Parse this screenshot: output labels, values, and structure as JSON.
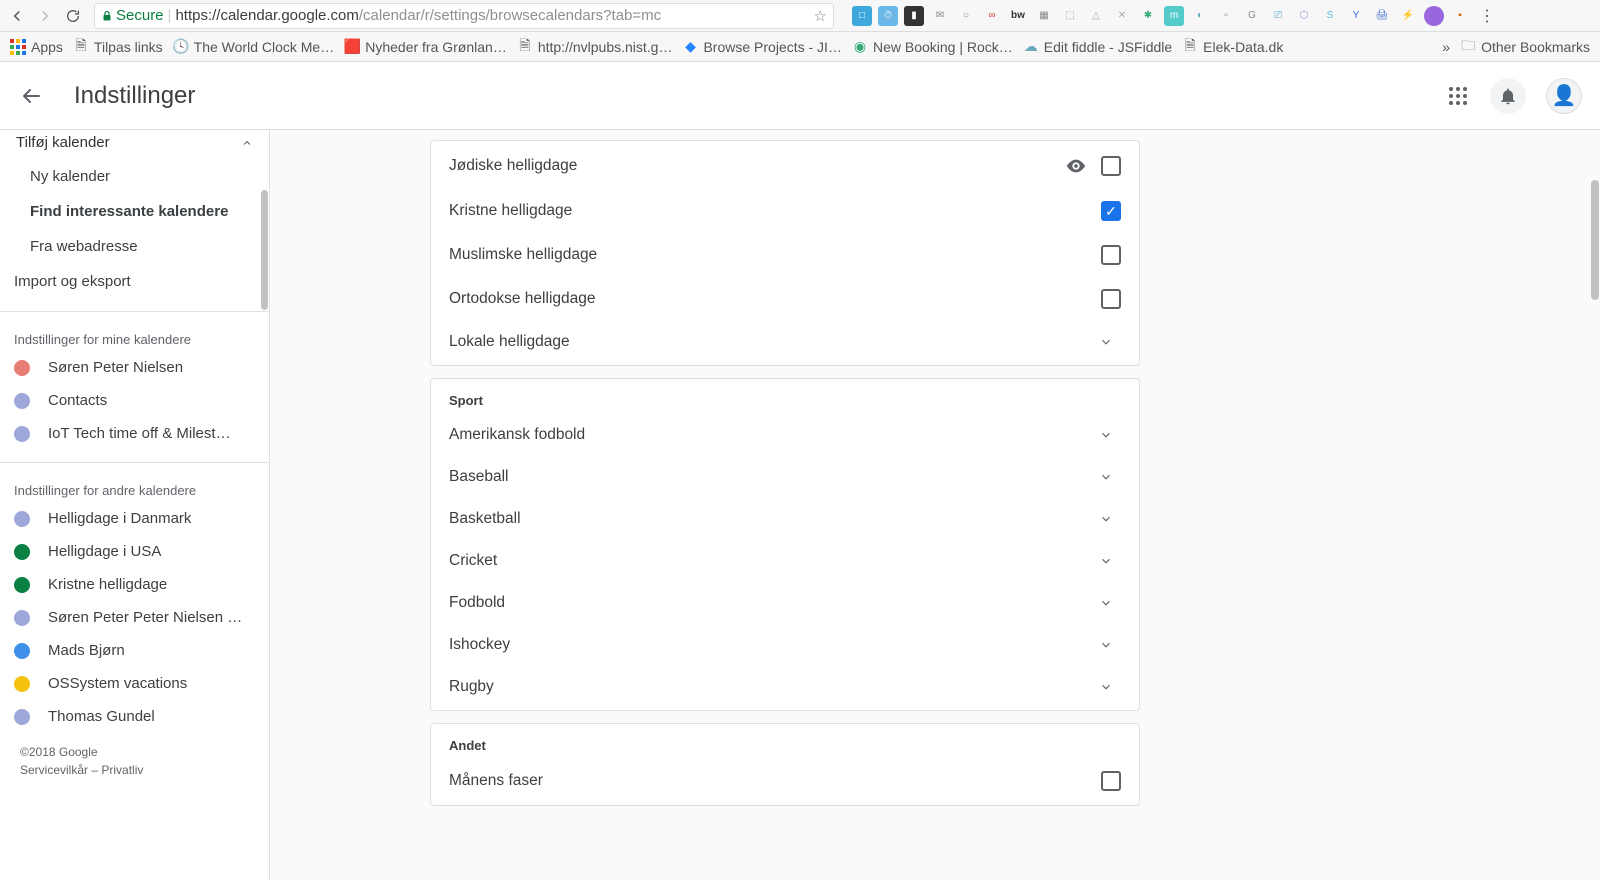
{
  "browser": {
    "secure_label": "Secure",
    "url_host": "https://calendar.google.com",
    "url_path": "/calendar/r/settings/browsecalendars?tab=mc"
  },
  "bookmarks": {
    "items": [
      {
        "label": "Apps",
        "icon": "apps"
      },
      {
        "label": "Tilpas links",
        "icon": "page"
      },
      {
        "label": "The World Clock Me…",
        "icon": "clock"
      },
      {
        "label": "Nyheder fra Grønlan…",
        "icon": "news"
      },
      {
        "label": "http://nvlpubs.nist.g…",
        "icon": "page"
      },
      {
        "label": "Browse Projects - JI…",
        "icon": "jira"
      },
      {
        "label": "New Booking | Rock…",
        "icon": "rock"
      },
      {
        "label": "Edit fiddle - JSFiddle",
        "icon": "fiddle"
      },
      {
        "label": "Elek-Data.dk",
        "icon": "page"
      }
    ],
    "overflow": "»",
    "other": "Other Bookmarks"
  },
  "header": {
    "title": "Indstillinger"
  },
  "sidebar": {
    "add_calendar_label": "Tilføj kalender",
    "menu": [
      {
        "label": "Ny kalender",
        "selected": false
      },
      {
        "label": "Find interessante kalendere",
        "selected": true
      },
      {
        "label": "Fra webadresse",
        "selected": false
      }
    ],
    "import_label": "Import og eksport",
    "my_heading": "Indstillinger for mine kalendere",
    "my_calendars": [
      {
        "label": "Søren Peter Nielsen",
        "color": "#e67c73"
      },
      {
        "label": "Contacts",
        "color": "#9fa8da"
      },
      {
        "label": "IoT Tech time off & Milest…",
        "color": "#9fa8da"
      }
    ],
    "other_heading": "Indstillinger for andre kalendere",
    "other_calendars": [
      {
        "label": "Helligdage i Danmark",
        "color": "#9fa8da"
      },
      {
        "label": "Helligdage i USA",
        "color": "#0b8043"
      },
      {
        "label": "Kristne helligdage",
        "color": "#0b8043"
      },
      {
        "label": "Søren Peter Peter Nielsen …",
        "color": "#9fa8da"
      },
      {
        "label": "Mads Bjørn",
        "color": "#3f90e8"
      },
      {
        "label": "OSSystem vacations",
        "color": "#f4c20d"
      },
      {
        "label": "Thomas Gundel",
        "color": "#9fa8da"
      }
    ],
    "footer_line1": "©2018 Google",
    "footer_line2": "Servicevilkår – Privatliv"
  },
  "main": {
    "holidays": [
      {
        "label": "Jødiske helligdage",
        "checked": false,
        "hover": true
      },
      {
        "label": "Kristne helligdage",
        "checked": true,
        "hover": false
      },
      {
        "label": "Muslimske helligdage",
        "checked": false,
        "hover": false
      },
      {
        "label": "Ortodokse helligdage",
        "checked": false,
        "hover": false
      }
    ],
    "holidays_expand": {
      "label": "Lokale helligdage"
    },
    "sport_title": "Sport",
    "sports": [
      {
        "label": "Amerikansk fodbold"
      },
      {
        "label": "Baseball"
      },
      {
        "label": "Basketball"
      },
      {
        "label": "Cricket"
      },
      {
        "label": "Fodbold"
      },
      {
        "label": "Ishockey"
      },
      {
        "label": "Rugby"
      }
    ],
    "other_title": "Andet",
    "other_rows": [
      {
        "label": "Månens faser",
        "checked": false
      }
    ]
  }
}
